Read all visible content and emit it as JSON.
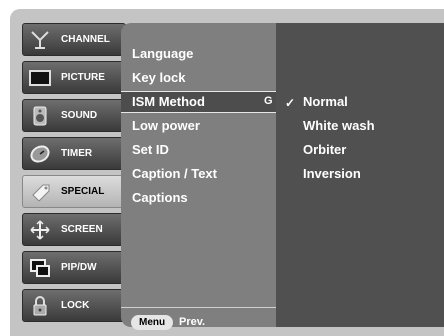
{
  "sidebar": {
    "items": [
      {
        "label": "CHANNEL",
        "icon": "antenna-icon"
      },
      {
        "label": "PICTURE",
        "icon": "tv-screen-icon"
      },
      {
        "label": "SOUND",
        "icon": "speaker-icon"
      },
      {
        "label": "TIMER",
        "icon": "clock-icon"
      },
      {
        "label": "SPECIAL",
        "icon": "tag-icon",
        "active": true
      },
      {
        "label": "SCREEN",
        "icon": "move-arrows-icon"
      },
      {
        "label": "PIP/DW",
        "icon": "pip-icon"
      },
      {
        "label": "LOCK",
        "icon": "padlock-icon"
      }
    ]
  },
  "menu": {
    "items": [
      "Language",
      "Key lock",
      "ISM Method",
      "Low power",
      "Set ID",
      "Caption / Text",
      "Captions"
    ],
    "selected_index": 2,
    "selected_hint": "G"
  },
  "options": {
    "items": [
      "Normal",
      "White wash",
      "Orbiter",
      "Inversion"
    ],
    "checked_index": 0,
    "check_mark": "✓"
  },
  "footer": {
    "menu_button": "Menu",
    "prev_label": "Prev."
  },
  "colors": {
    "frame": "#c4c4c4",
    "menu_panel": "#7f7f7f",
    "options_panel": "#505050",
    "nav_button": "#4a4a4a",
    "nav_active": "#cfcfcf"
  }
}
